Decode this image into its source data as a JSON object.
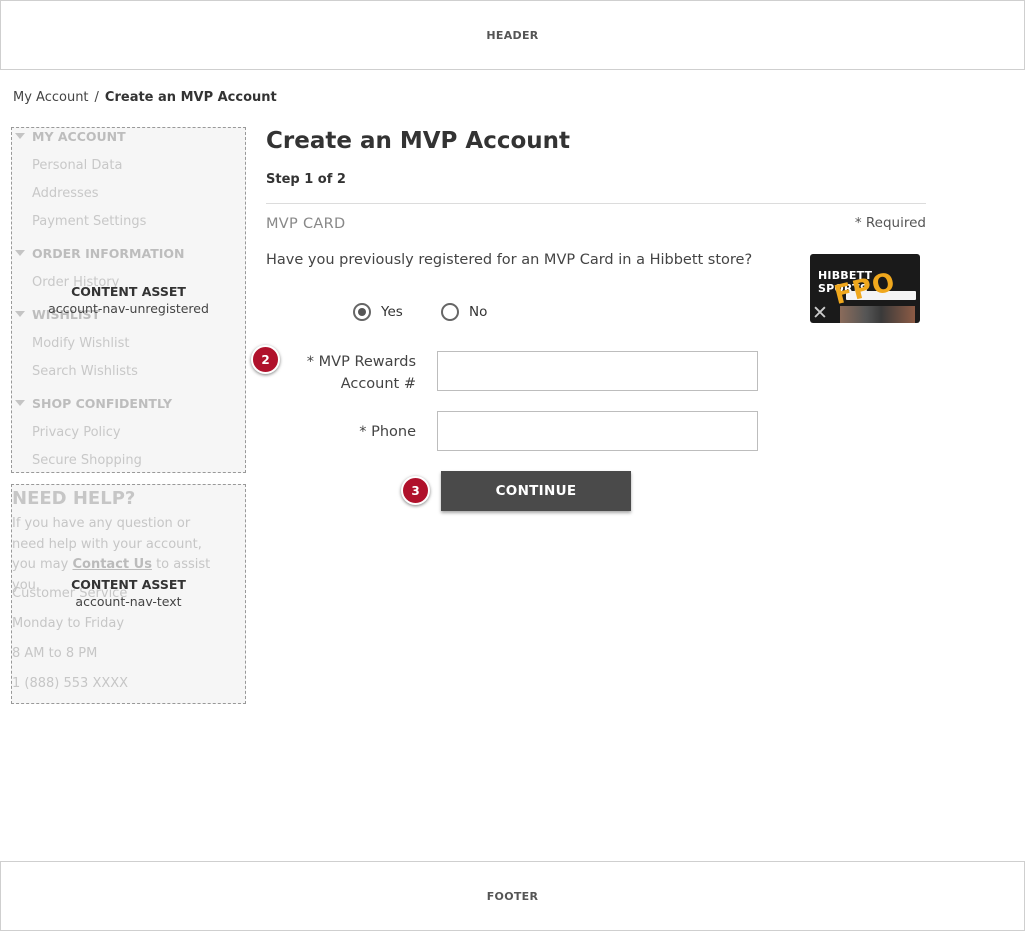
{
  "header": {
    "label": "HEADER"
  },
  "footer": {
    "label": "FOOTER"
  },
  "breadcrumb": {
    "parent": "My Account",
    "separator": "/",
    "current": "Create an MVP Account"
  },
  "account_nav": {
    "groups": [
      {
        "title": "MY ACCOUNT",
        "links": [
          "Personal Data",
          "Addresses",
          "Payment Settings"
        ]
      },
      {
        "title": "ORDER INFORMATION",
        "links": [
          "Order History"
        ]
      },
      {
        "title": "WISHLIST",
        "links": [
          "Modify Wishlist",
          "Search Wishlists"
        ]
      },
      {
        "title": "SHOP CONFIDENTLY",
        "links": [
          "Privacy Policy",
          "Secure Shopping"
        ]
      }
    ],
    "asset_title": "CONTENT ASSET",
    "asset_id": "account-nav-unregistered"
  },
  "help": {
    "title": "NEED HELP?",
    "text_before": "If you have any question or need help with your account, you may ",
    "contact_link": "Contact Us",
    "text_after": " to assist you.",
    "service_label": "Customer Service",
    "days": "Monday to Friday",
    "hours": "8 AM to 8 PM",
    "phone": "1 (888) 553 XXXX",
    "asset_title": "CONTENT ASSET",
    "asset_id": "account-nav-text"
  },
  "form": {
    "title": "Create an MVP Account",
    "step": "Step 1 of 2",
    "section": "MVP CARD",
    "required_note": "* Required",
    "question": "Have you previously registered for an MVP Card in a Hibbett store?",
    "card": {
      "brand": "HIBBETT SPORTS",
      "placeholder": "FPO"
    },
    "options": [
      {
        "label": "Yes",
        "selected": true
      },
      {
        "label": "No",
        "selected": false
      }
    ],
    "account_label_line1": "*  MVP Rewards",
    "account_label_line2": "Account #",
    "account_value": "",
    "phone_label": "* Phone",
    "phone_value": "",
    "continue_label": "CONTINUE",
    "badges": [
      "2",
      "3"
    ]
  },
  "colors": {
    "badge": "#b0112b",
    "button": "#4a4a4a"
  }
}
